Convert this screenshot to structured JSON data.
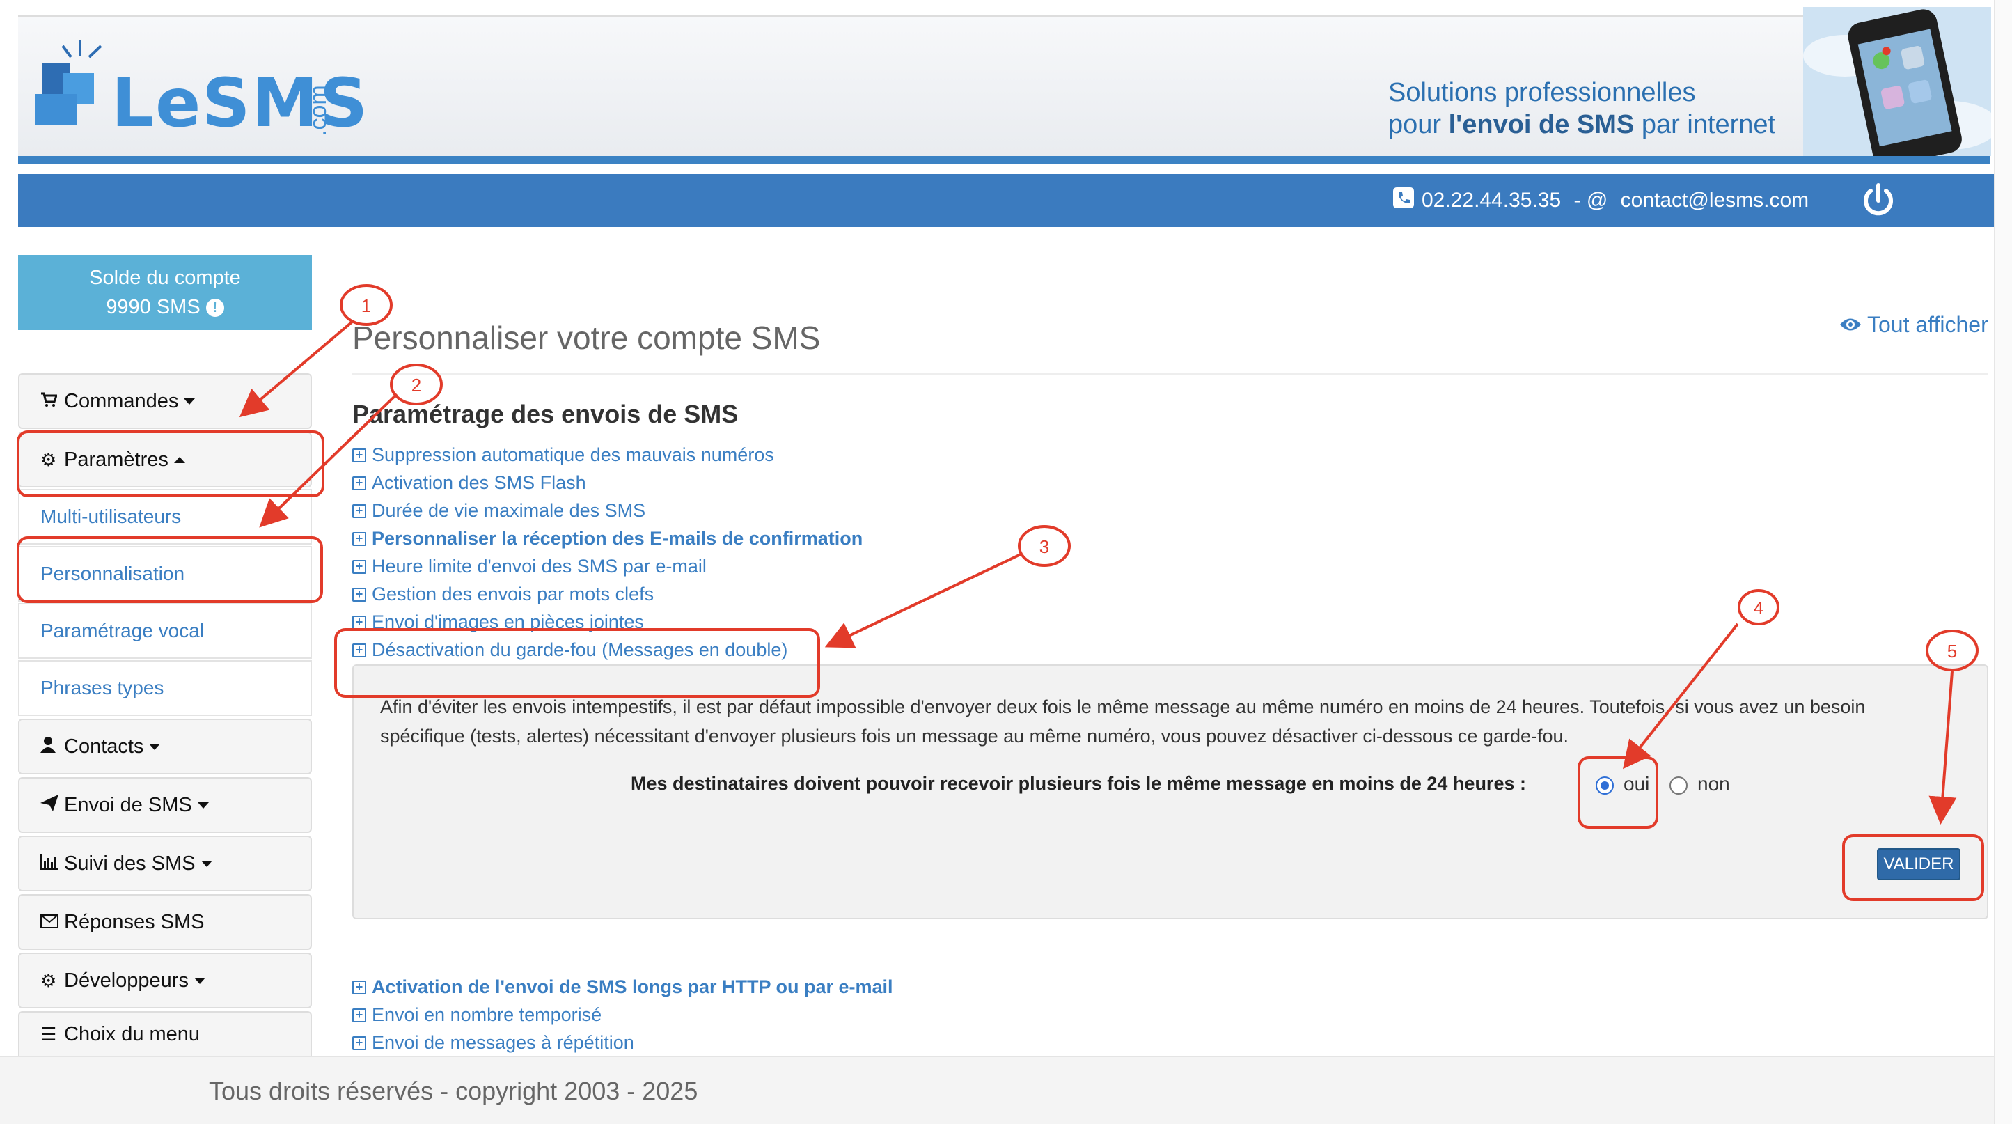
{
  "header": {
    "logo_text": "LeSMS",
    "logo_suffix": ".com",
    "tagline_line1": "Solutions professionnelles",
    "tagline_line2_a": "pour ",
    "tagline_line2_b": "l'envoi de SMS",
    "tagline_line2_c": " par internet",
    "phone": "02.22.44.35.35",
    "separator": " - @ ",
    "email": "contact@lesms.com",
    "brand_color": "#3b7bbf"
  },
  "sidebar": {
    "solde_label": "Solde du compte",
    "solde_value": "9990 SMS",
    "items": [
      {
        "label": "Commandes",
        "icon": "cart-icon",
        "caret": "down"
      },
      {
        "label": "Paramètres",
        "icon": "gear-icon",
        "caret": "up"
      },
      {
        "label": "Multi-utilisateurs",
        "sub": true
      },
      {
        "label": "Personnalisation",
        "sub": true
      },
      {
        "label": "Paramétrage vocal",
        "sub": true
      },
      {
        "label": "Phrases types",
        "sub": true
      },
      {
        "label": "Contacts",
        "icon": "user-icon",
        "caret": "down"
      },
      {
        "label": "Envoi de SMS",
        "icon": "send-icon",
        "caret": "down"
      },
      {
        "label": "Suivi des SMS",
        "icon": "chart-icon",
        "caret": "down"
      },
      {
        "label": "Réponses SMS",
        "icon": "envelope-icon"
      },
      {
        "label": "Développeurs",
        "icon": "gear-icon",
        "caret": "down"
      },
      {
        "label": "Choix du menu",
        "icon": "menu-icon"
      }
    ]
  },
  "main": {
    "title": "Personnaliser votre compte SMS",
    "tout_afficher": "Tout afficher",
    "section_title": "Paramétrage des envois de SMS",
    "links": [
      {
        "label": "Suppression automatique des mauvais numéros",
        "bold": false
      },
      {
        "label": "Activation des SMS Flash",
        "bold": false
      },
      {
        "label": "Durée de vie maximale des SMS",
        "bold": false
      },
      {
        "label": "Personnaliser la réception des E-mails de confirmation",
        "bold": true
      },
      {
        "label": "Heure limite d'envoi des SMS par e-mail",
        "bold": false
      },
      {
        "label": "Gestion des envois par mots clefs",
        "bold": false
      },
      {
        "label": "Envoi d'images en pièces jointes",
        "bold": false
      },
      {
        "label": "Désactivation du garde-fou (Messages en double)",
        "bold": false
      }
    ],
    "panel": {
      "description": "Afin d'éviter les envois intempestifs, il est par défaut impossible d'envoyer deux fois le même message au même numéro en moins de 24 heures. Toutefois, si vous avez un besoin spécifique (tests, alertes) nécessitant d'envoyer plusieurs fois un message au même numéro, vous pouvez désactiver ci-dessous ce garde-fou.",
      "question": "Mes destinataires doivent pouvoir recevoir plusieurs fois le même message en moins de 24 heures :",
      "option_yes": "oui",
      "option_no": "non",
      "selected": "oui",
      "submit": "VALIDER"
    },
    "links_after": [
      {
        "label": "Activation de l'envoi de SMS longs par HTTP ou par e-mail",
        "bold": true
      },
      {
        "label": "Envoi en nombre temporisé",
        "bold": false
      },
      {
        "label": "Envoi de messages à répétition",
        "bold": false
      }
    ]
  },
  "annotations": {
    "color": "#e23b2a",
    "numbers": [
      "1",
      "2",
      "3",
      "4",
      "5"
    ]
  },
  "footer": {
    "copyright": "Tous droits réservés - copyright 2003 - 2025"
  }
}
